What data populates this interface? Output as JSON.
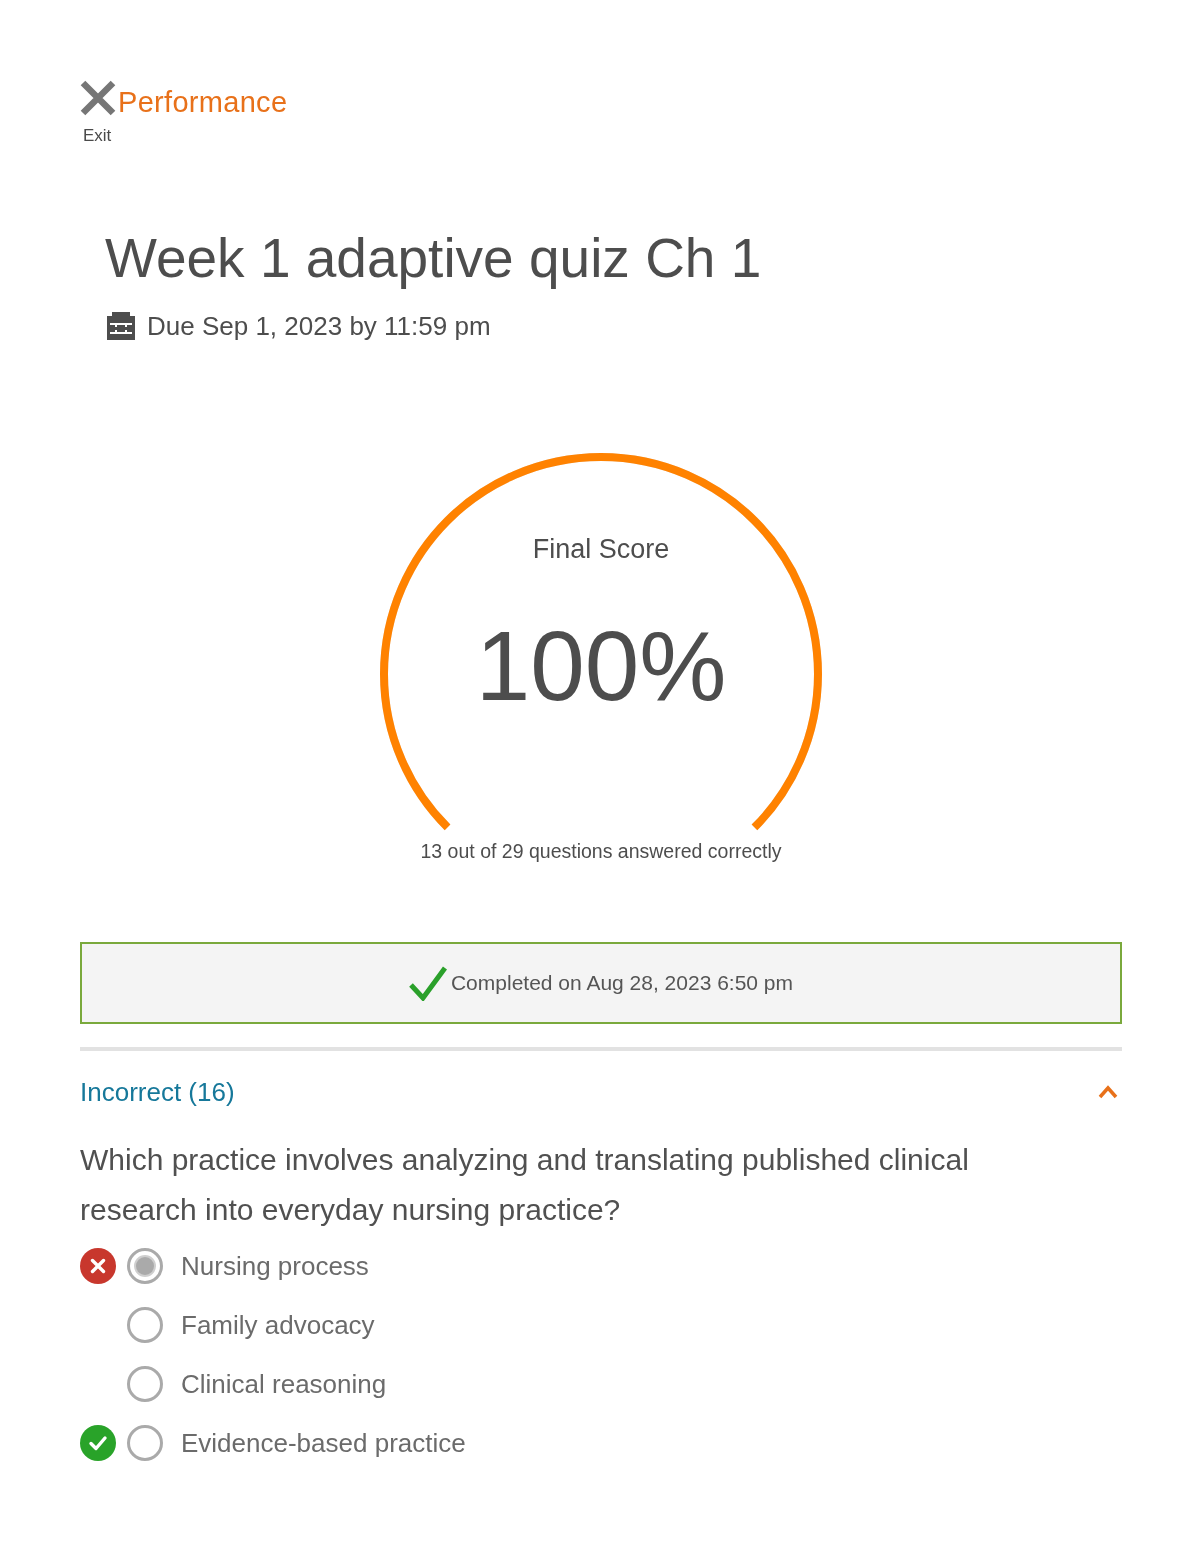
{
  "header": {
    "exit_label": "Exit",
    "title": "Performance"
  },
  "quiz": {
    "title": "Week 1 adaptive quiz Ch 1",
    "due": "Due Sep 1, 2023 by 11:59 pm"
  },
  "score": {
    "label": "Final Score",
    "value": "100%",
    "level": 1,
    "caption": "13 out of 29 questions answered correctly"
  },
  "completion": {
    "text": "Completed on Aug 28, 2023 6:50 pm"
  },
  "section": {
    "title": "Incorrect (16)",
    "expanded": true
  },
  "question": {
    "text": "Which practice involves analyzing and translating published clinical research into everyday nursing practice?",
    "options": [
      {
        "label": "Nursing process",
        "selected": true,
        "correct": false
      },
      {
        "label": "Family advocacy",
        "selected": false,
        "correct": false
      },
      {
        "label": "Clinical reasoning",
        "selected": false,
        "correct": false
      },
      {
        "label": "Evidence-based practice",
        "selected": false,
        "correct": true
      }
    ]
  }
}
